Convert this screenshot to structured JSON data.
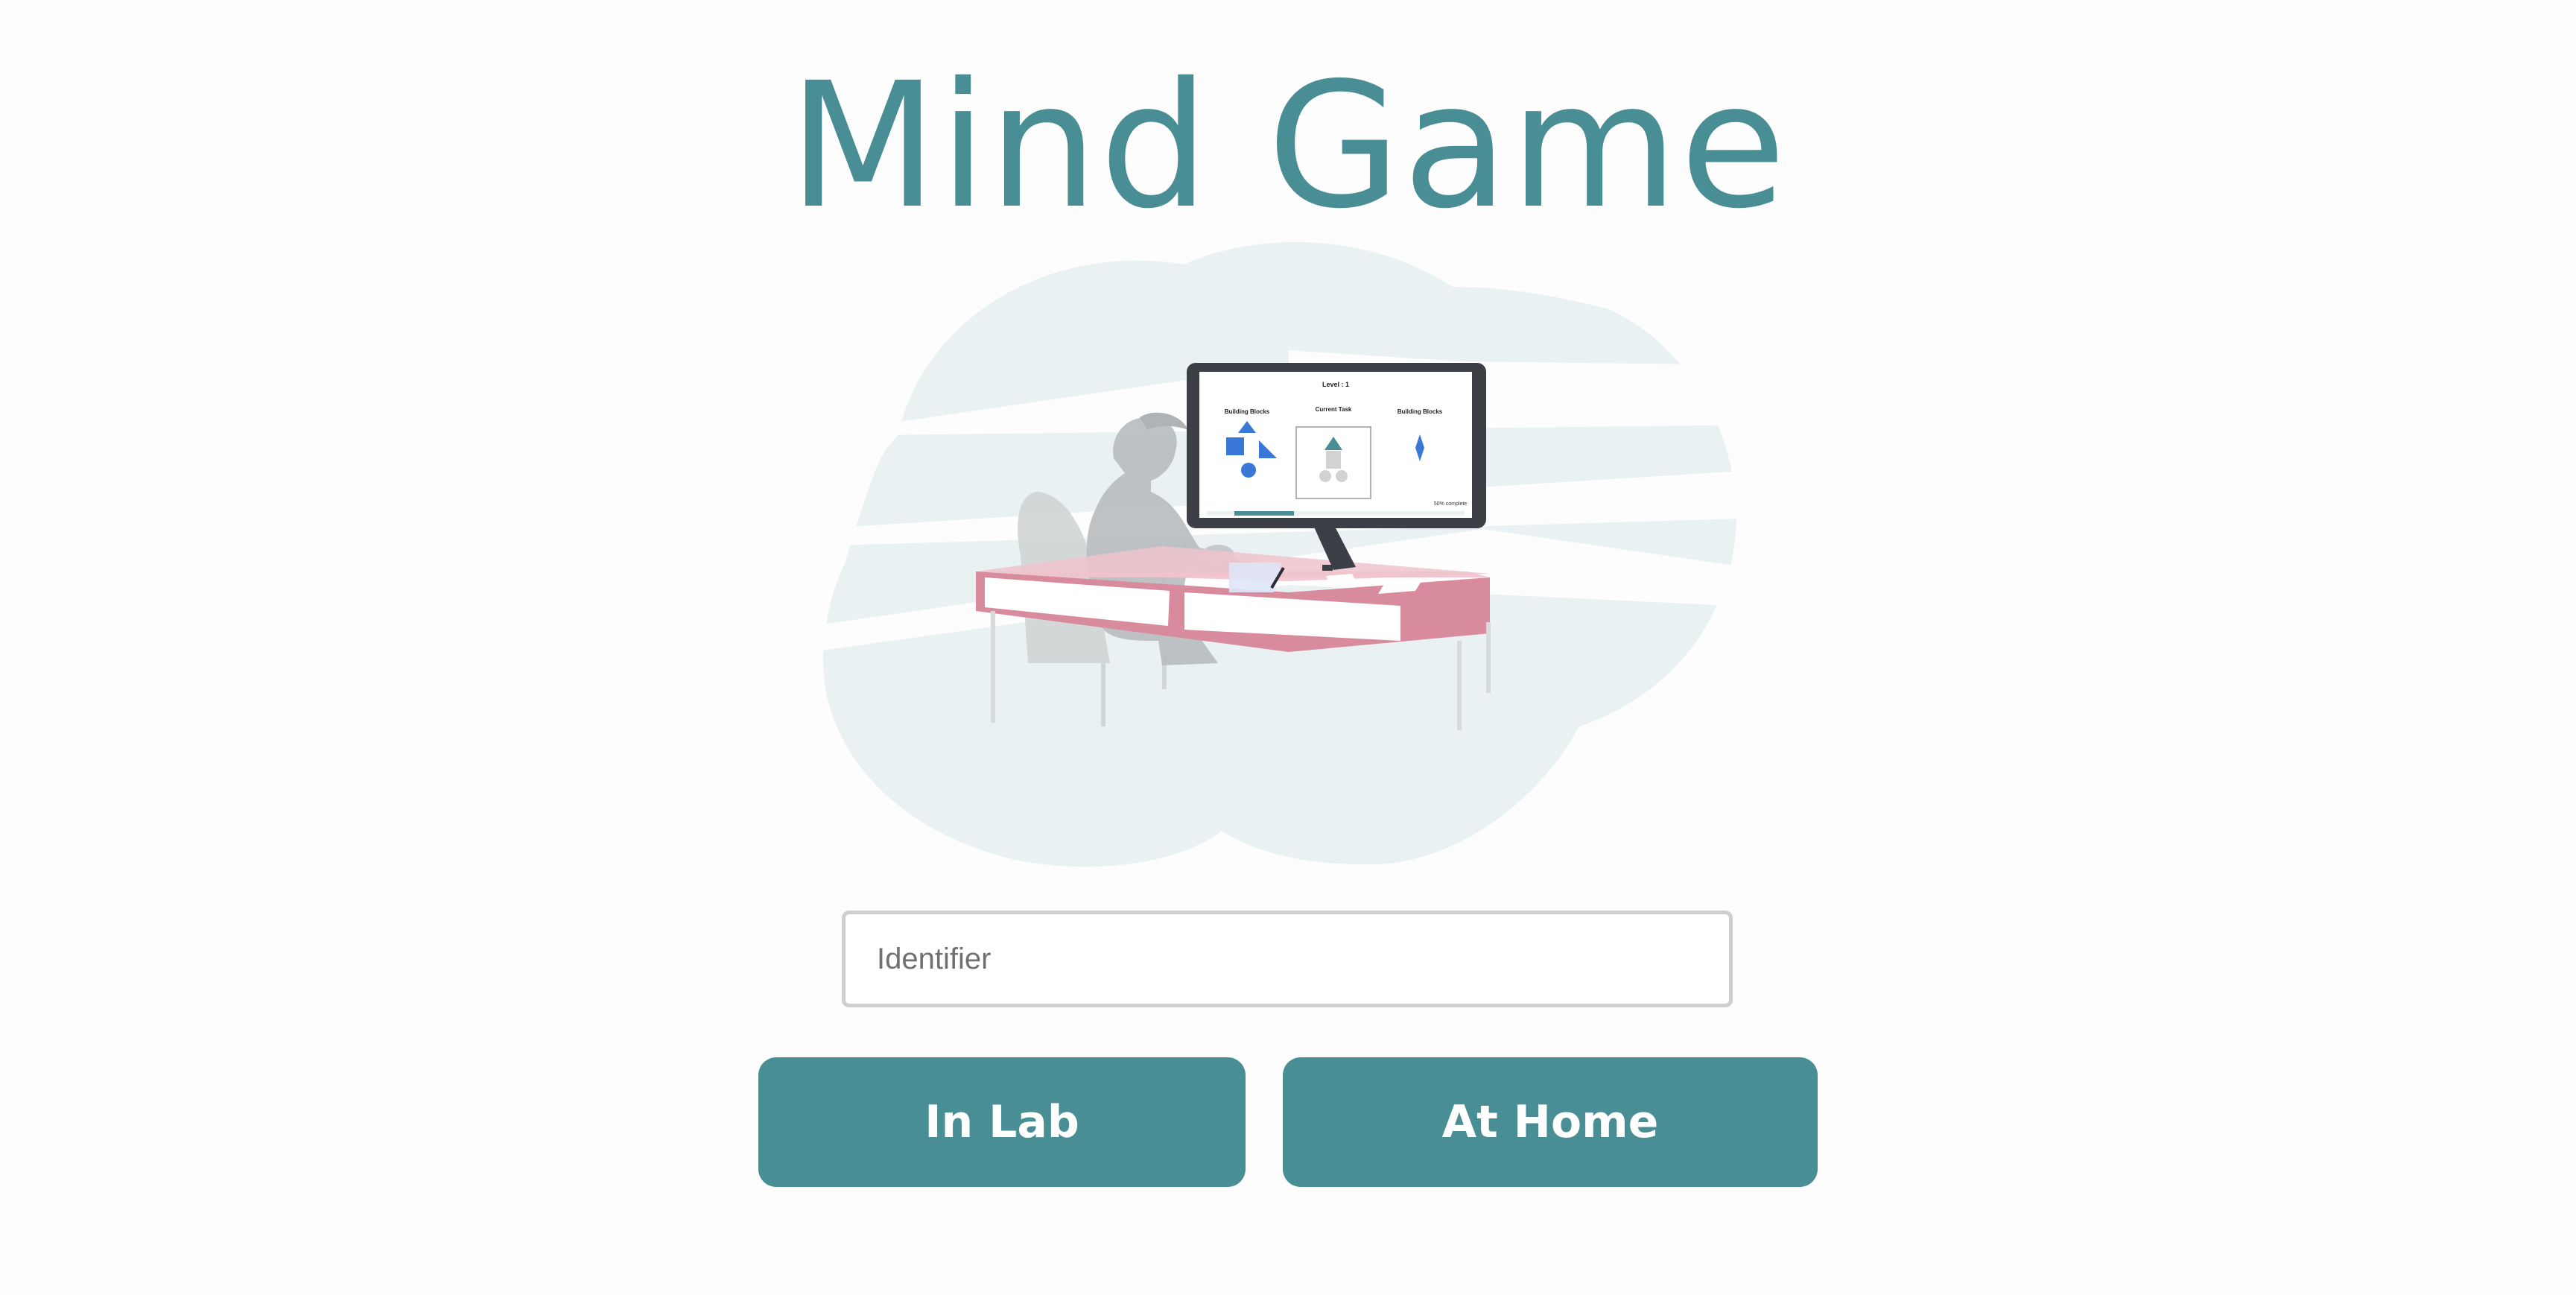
{
  "app": {
    "title": "Mind Game"
  },
  "illustration": {
    "icon": "person-at-computer-illustration",
    "screen": {
      "level_label": "Level : 1",
      "left_panel_title": "Building Blocks",
      "center_panel_title": "Current Task",
      "right_panel_title": "Building Blocks",
      "progress_text": "50% complete",
      "progress_fraction": 0.5
    },
    "colors": {
      "cloud": "#eaf1f2",
      "desk": "#d98b9e",
      "desk_top": "#eec3cc",
      "monitor": "#3d3f46",
      "shape_blue": "#3a78d8",
      "accent": "#498e94"
    }
  },
  "form": {
    "identifier_placeholder": "Identifier",
    "identifier_value": ""
  },
  "actions": {
    "in_lab_label": "In Lab",
    "at_home_label": "At Home"
  },
  "theme": {
    "accent": "#498e94",
    "background": "#fdfdfd"
  }
}
